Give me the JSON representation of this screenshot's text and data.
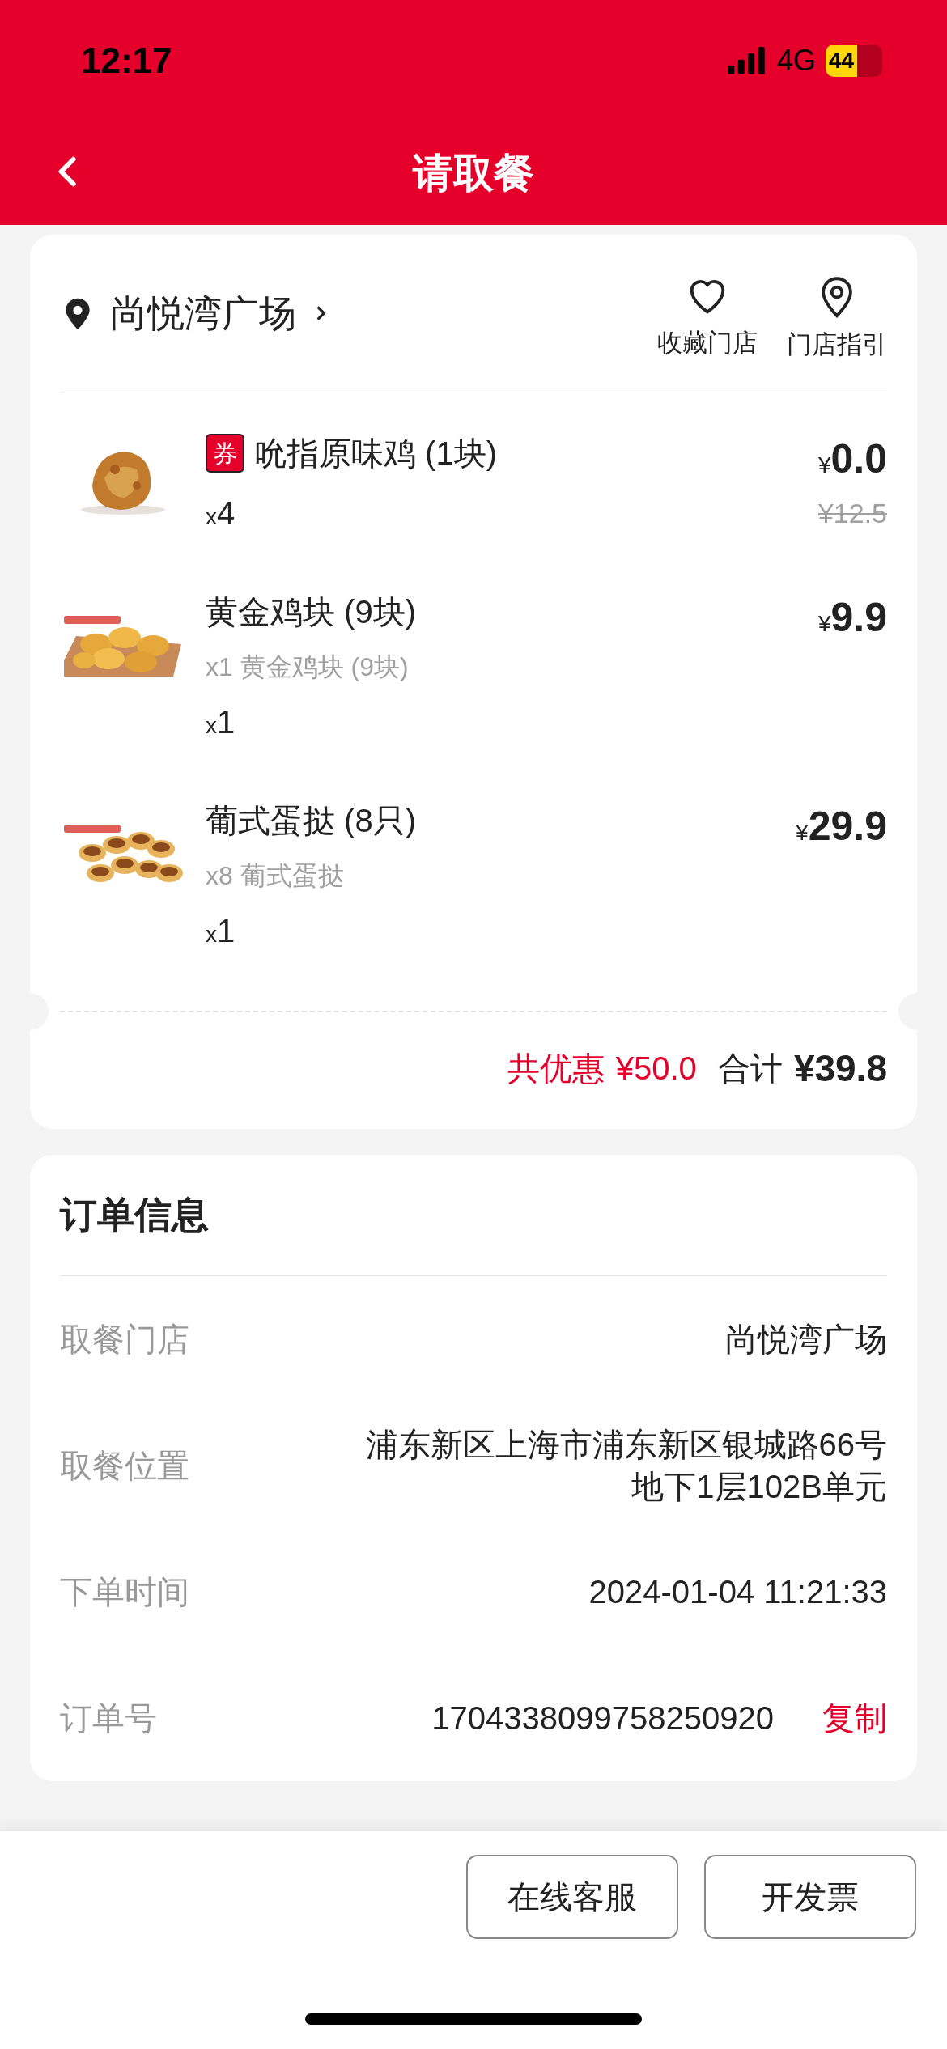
{
  "status_bar": {
    "time": "12:17",
    "network": "4G",
    "battery": "44"
  },
  "nav": {
    "title": "请取餐"
  },
  "store": {
    "name": "尚悦湾广场",
    "actions": [
      {
        "kind": "favorite",
        "label": "收藏门店"
      },
      {
        "kind": "guide",
        "label": "门店指引"
      }
    ]
  },
  "items": [
    {
      "badge": "券",
      "name": "吮指原味鸡 (1块)",
      "qty_mark": "x",
      "qty": "4",
      "currency": "¥",
      "price": "0.0",
      "original_price": "¥12.5"
    },
    {
      "name": "黄金鸡块 (9块)",
      "detail": "x1 黄金鸡块 (9块)",
      "qty_mark": "x",
      "qty": "1",
      "currency": "¥",
      "price": "9.9"
    },
    {
      "name": "葡式蛋挞 (8只)",
      "detail": "x8 葡式蛋挞",
      "qty_mark": "x",
      "qty": "1",
      "currency": "¥",
      "price": "29.9"
    }
  ],
  "summary": {
    "discount_label": "共优惠",
    "discount": "¥50.0",
    "total_label": "合计",
    "total": "¥39.8"
  },
  "order_info": {
    "title": "订单信息",
    "rows": [
      {
        "label": "取餐门店",
        "value": "尚悦湾广场"
      },
      {
        "label": "取餐位置",
        "value": "浦东新区上海市浦东新区银城路66号地下1层102B单元"
      },
      {
        "label": "下单时间",
        "value": "2024-01-04 11:21:33"
      },
      {
        "label": "订单号",
        "value": "1704338099758250920",
        "action": "复制"
      }
    ]
  },
  "footer": {
    "buttons": [
      "在线客服",
      "开发票"
    ]
  }
}
